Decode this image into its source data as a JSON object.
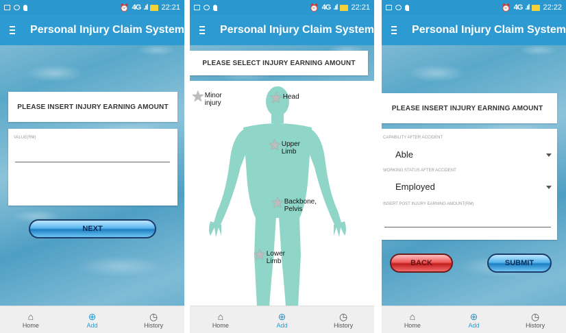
{
  "status_left": {
    "time1": "22:21",
    "time2": "22:21",
    "time3": "22:22"
  },
  "app": {
    "title": "Personal Injury Claim System"
  },
  "status": {
    "network": "4G"
  },
  "screen1": {
    "card_title": "PLEASE INSERT INJURY EARNING AMOUNT",
    "value_label": "VALUE(RM)",
    "value": "",
    "next_label": "NEXT"
  },
  "screen2": {
    "card_title": "PLEASE SELECT INJURY EARNING AMOUNT",
    "points": [
      {
        "label_line1": "Minor",
        "label_line2": "injury"
      },
      {
        "label_line1": "Head",
        "label_line2": ""
      },
      {
        "label_line1": "Upper",
        "label_line2": "Limb"
      },
      {
        "label_line1": "Backbone,",
        "label_line2": "Pelvis"
      },
      {
        "label_line1": "Lower",
        "label_line2": "Limb"
      }
    ]
  },
  "screen3": {
    "card_title": "PLEASE INSERT INJURY EARNING AMOUNT",
    "capability_label": "CAPABILITY AFTER ACCIDENT",
    "capability_value": "Able",
    "working_label": "WORKING STATUS AFTER ACCIDENT",
    "working_value": "Employed",
    "post_label": "INSERT POST INJURY EARNING AMOUNT(RM)",
    "back_label": "BACK",
    "submit_label": "SUBMIT"
  },
  "nav": {
    "home": "Home",
    "add": "Add",
    "history": "History"
  },
  "colors": {
    "primary": "#2e9ad2",
    "body_figure": "#8fd6c8"
  }
}
